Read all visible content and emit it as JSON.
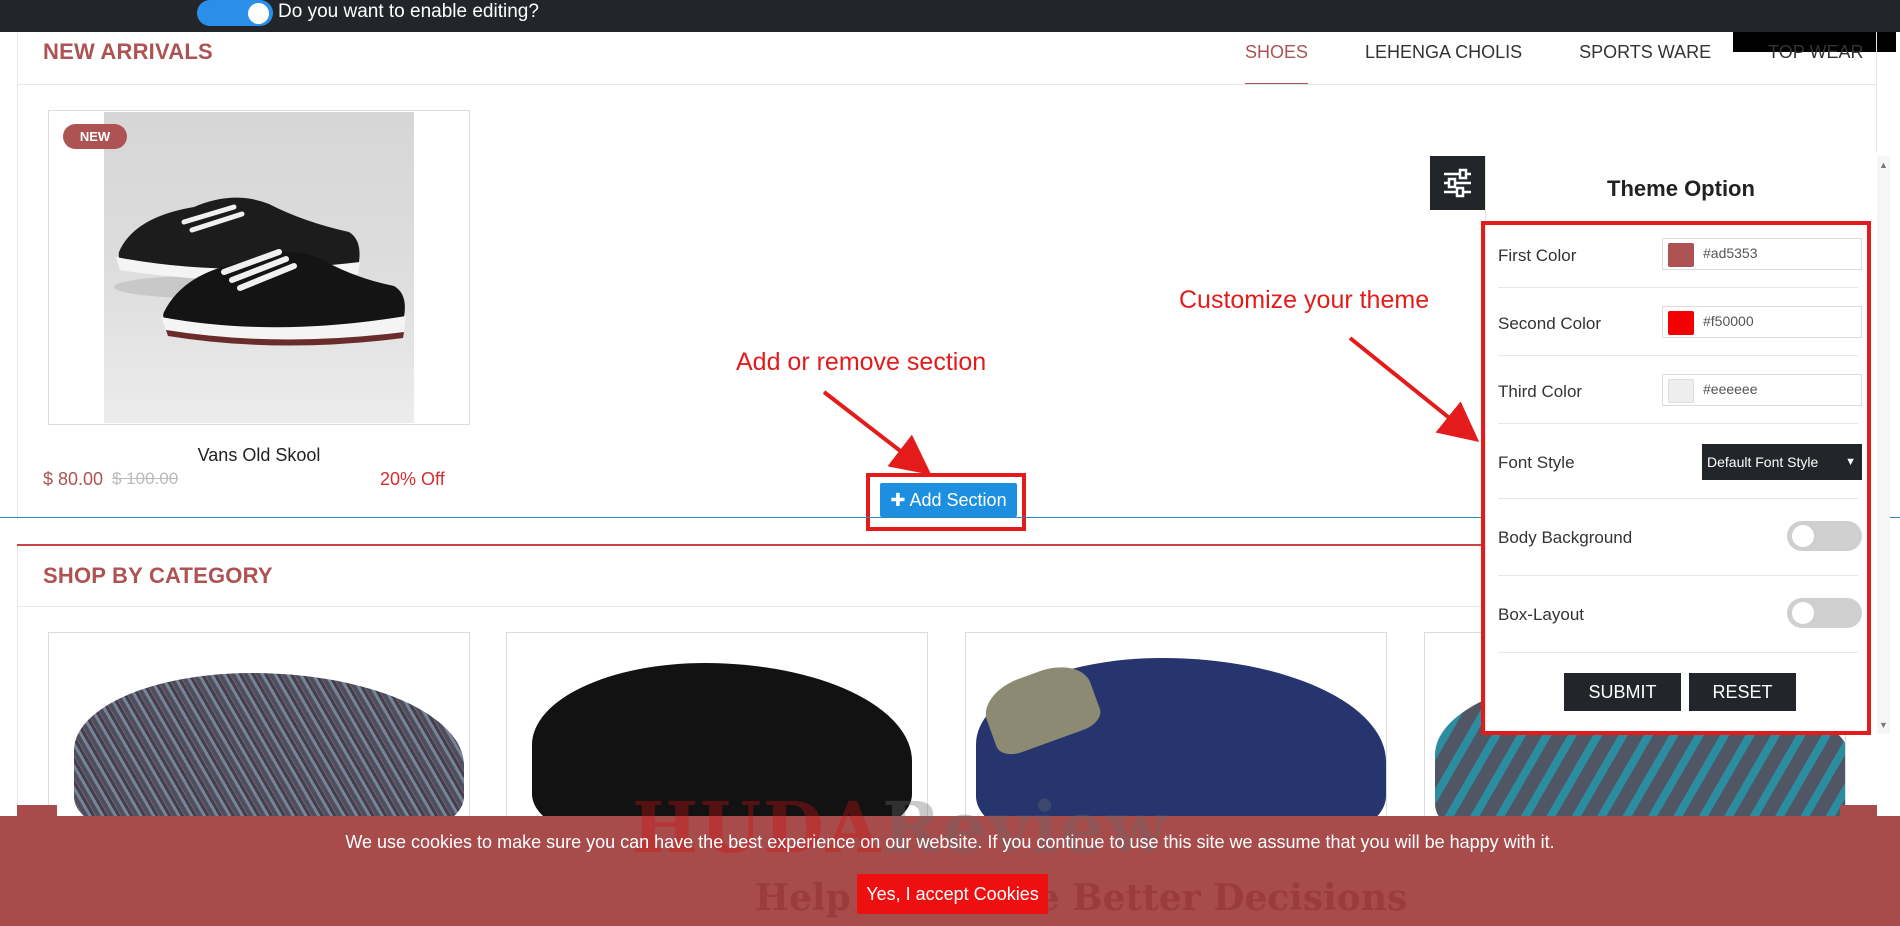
{
  "edit_bar": {
    "label": "Do you want to enable editing?",
    "toggle_on": true
  },
  "new_arrivals": {
    "title": "NEW ARRIVALS",
    "tabs": [
      {
        "label": "SHOES",
        "active": true
      },
      {
        "label": "LEHENGA CHOLIS",
        "active": false
      },
      {
        "label": "SPORTS WARE",
        "active": false
      },
      {
        "label": "TOP WEAR",
        "active": false
      }
    ],
    "product": {
      "badge": "NEW",
      "name": "Vans Old Skool",
      "price": "$ 80.00",
      "old_price": "$ 100.00",
      "discount": "20% Off"
    }
  },
  "annotations": {
    "add_section": "Add or remove section",
    "customize_theme": "Customize your theme"
  },
  "add_section_button": {
    "label": "Add Section",
    "icon": "plus-icon"
  },
  "shop_by_category": {
    "title": "SHOP BY CATEGORY"
  },
  "theme_option": {
    "title": "Theme Option",
    "settings_icon": "sliders-icon",
    "first_color": {
      "label": "First Color",
      "value": "#ad5353"
    },
    "second_color": {
      "label": "Second Color",
      "value": "#f50000"
    },
    "third_color": {
      "label": "Third Color",
      "value": "#eeeeee"
    },
    "font_style": {
      "label": "Font Style",
      "selected": "Default Font Style"
    },
    "body_background": {
      "label": "Body Background",
      "enabled": false
    },
    "box_layout": {
      "label": "Box-Layout",
      "enabled": false
    },
    "submit_label": "SUBMIT",
    "reset_label": "RESET"
  },
  "cookie": {
    "text": "We use cookies to make sure you can have the best experience on our website. If you continue to use this site we assume that you will be happy with it.",
    "accept_label": "Yes, I accept Cookies"
  },
  "watermark": {
    "logo_a": "HUDA",
    "logo_b": "Review",
    "tagline": "Help You Make Better Decisions"
  },
  "colors": {
    "accent": "#ad5353",
    "annotation": "#e41b1b",
    "button_blue": "#1d8fe0",
    "dark": "#22262b"
  }
}
